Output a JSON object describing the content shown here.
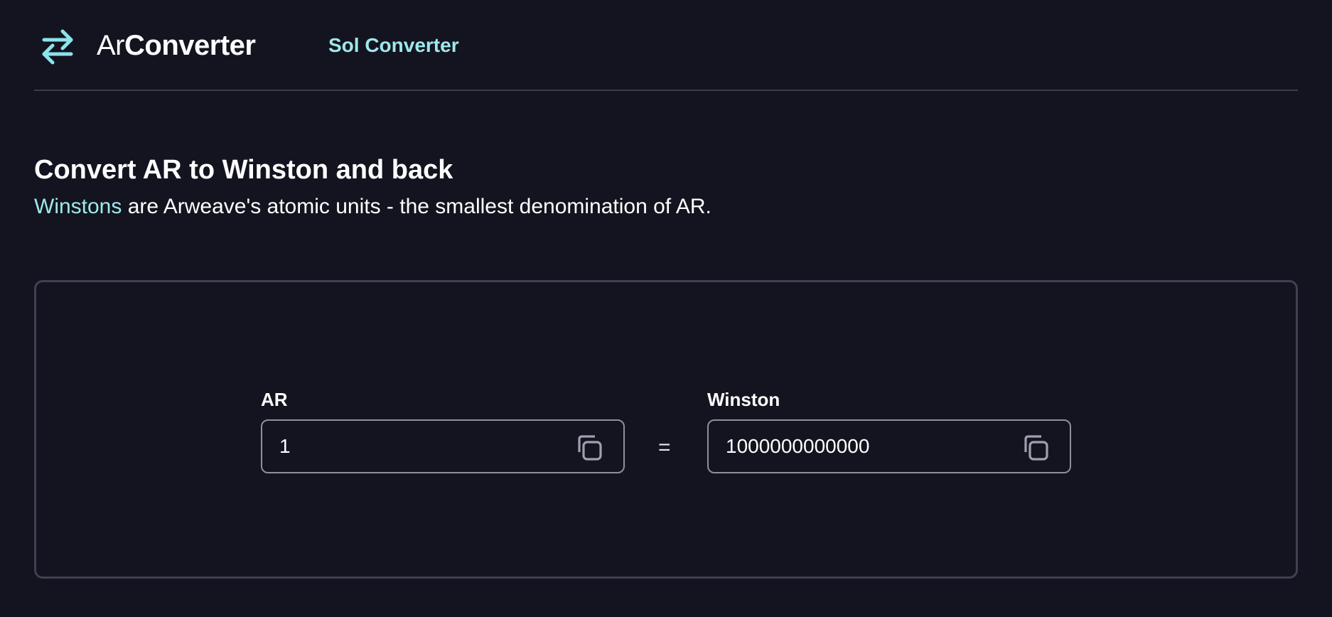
{
  "brand": {
    "name_light": "Ar",
    "name_bold": "Converter",
    "icon": "swap-arrows-icon",
    "accent_color": "#9ee8ec"
  },
  "nav": {
    "link_label": "Sol Converter"
  },
  "main": {
    "title": "Convert AR to Winston and back",
    "subtitle_link": "Winstons",
    "subtitle_rest": " are Arweave's atomic units - the smallest denomination of AR."
  },
  "converter": {
    "ar": {
      "label": "AR",
      "value": "1",
      "copy_icon": "copy-icon"
    },
    "equals": "=",
    "winston": {
      "label": "Winston",
      "value": "1000000000000",
      "copy_icon": "copy-icon"
    }
  }
}
